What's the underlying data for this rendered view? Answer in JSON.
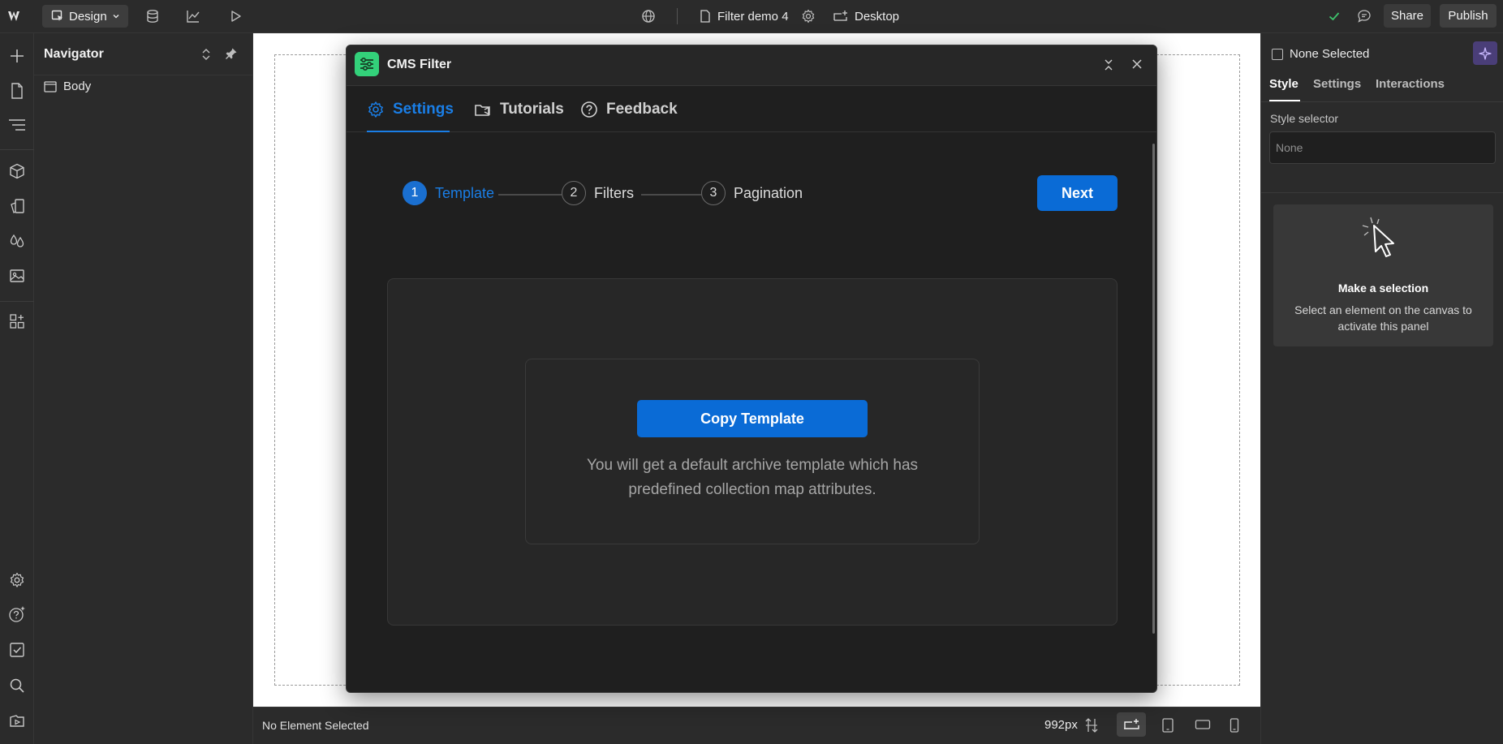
{
  "topbar": {
    "design_label": "Design",
    "page_name": "Filter demo 4",
    "breakpoint_label": "Desktop",
    "share_label": "Share",
    "publish_label": "Publish"
  },
  "navigator": {
    "title": "Navigator",
    "items": [
      {
        "label": "Body"
      }
    ]
  },
  "right_panel": {
    "selection_label": "None Selected",
    "tabs": [
      "Style",
      "Settings",
      "Interactions"
    ],
    "active_tab": "Style",
    "style_selector_label": "Style selector",
    "style_selector_placeholder": "None",
    "empty_title": "Make a selection",
    "empty_desc": "Select an element on the canvas to activate this panel"
  },
  "modal": {
    "title": "CMS Filter",
    "tabs": [
      {
        "label": "Settings",
        "active": true
      },
      {
        "label": "Tutorials",
        "active": false
      },
      {
        "label": "Feedback",
        "active": false
      }
    ],
    "steps": [
      {
        "number": "1",
        "label": "Template",
        "active": true
      },
      {
        "number": "2",
        "label": "Filters",
        "active": false
      },
      {
        "number": "3",
        "label": "Pagination",
        "active": false
      }
    ],
    "next_label": "Next",
    "copy_button_label": "Copy Template",
    "description": "You will get a default archive template which has predefined collection map attributes."
  },
  "bottom_bar": {
    "status": "No Element Selected",
    "width_label": "992px"
  },
  "colors": {
    "accent": "#0a6bd6",
    "logo_green": "#33d17a",
    "panel_bg": "#2b2b2b",
    "modal_bg": "#1f1f1f"
  }
}
